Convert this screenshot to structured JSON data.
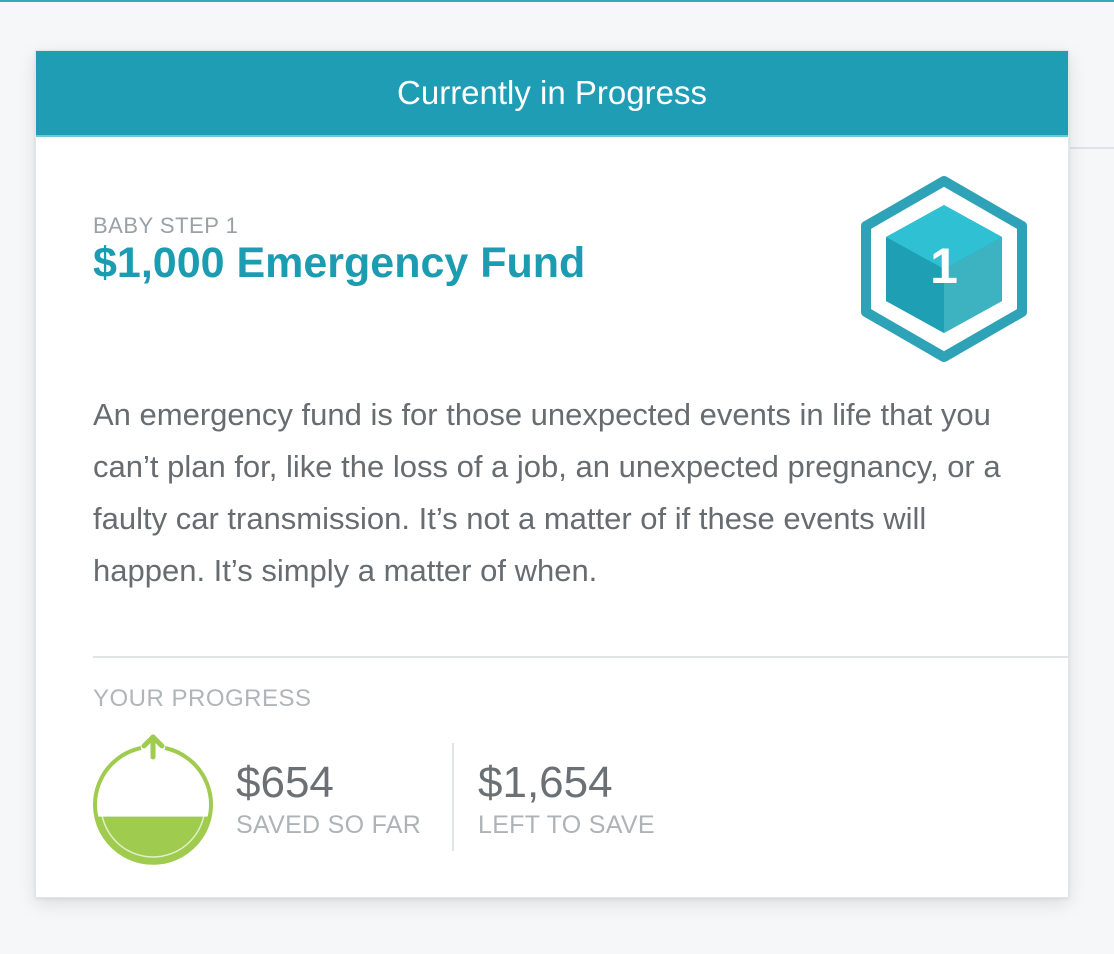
{
  "header": {
    "title": "Currently in Progress"
  },
  "step": {
    "label": "BABY STEP 1",
    "title": "$1,000 Emergency Fund",
    "badge_number": "1",
    "description": "An emergency fund is for those unexpected events in life that you can’t plan for, like the loss of a job, an unexpected pregnancy, or a faulty car transmission. It’s not a matter of if these events will happen. It’s simply a matter of when."
  },
  "progress": {
    "label": "YOUR PROGRESS",
    "fill_fraction": 0.4,
    "saved_value": "$654",
    "saved_caption": "SAVED SO FAR",
    "left_value": "$1,654",
    "left_caption": "LEFT TO SAVE"
  },
  "colors": {
    "header_bg": "#1e9db5",
    "title": "#1c9cb1",
    "gauge_green": "#9fcb4f"
  },
  "icons": {
    "badge": "hexagon-cube-icon",
    "gauge": "progress-gauge-icon",
    "arrow": "up-arrow-icon"
  }
}
